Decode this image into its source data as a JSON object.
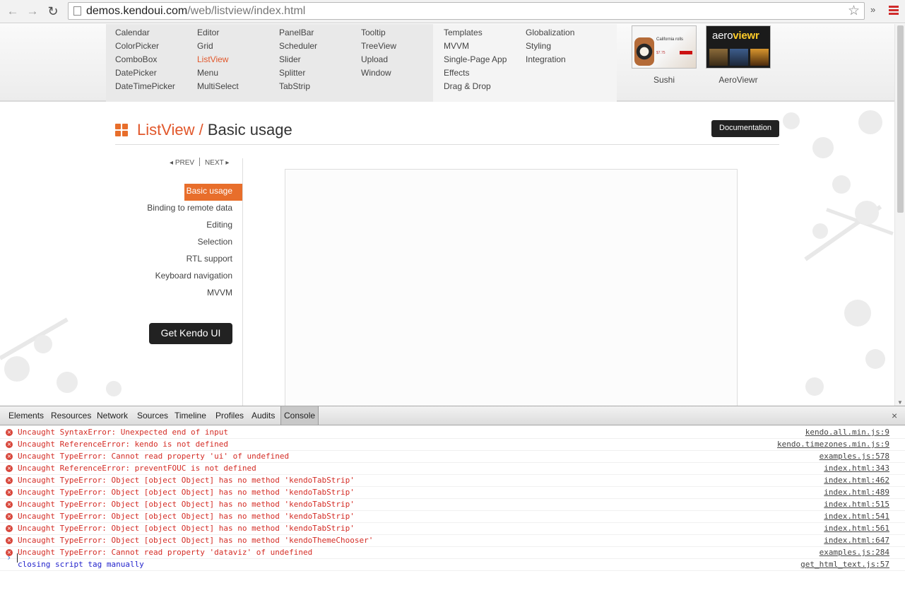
{
  "browser": {
    "url_host": "demos.kendoui.com",
    "url_path": "/web/listview/index.html"
  },
  "menu": {
    "col1": [
      "Calendar",
      "ColorPicker",
      "ComboBox",
      "DatePicker",
      "DateTimePicker"
    ],
    "col2": [
      "Editor",
      "Grid",
      "ListView",
      "Menu",
      "MultiSelect"
    ],
    "col3": [
      "PanelBar",
      "Scheduler",
      "Slider",
      "Splitter",
      "TabStrip"
    ],
    "col4": [
      "Tooltip",
      "TreeView",
      "Upload",
      "Window"
    ],
    "col5": [
      "Templates",
      "MVVM",
      "Single-Page App",
      "Effects",
      "Drag & Drop"
    ],
    "col6": [
      "Globalization",
      "Styling",
      "Integration"
    ],
    "active": "ListView",
    "showcase": [
      {
        "label": "Sushi",
        "thumb_title": "California rolls",
        "thumb_price": "$7.75"
      },
      {
        "label": "AeroViewr",
        "logo_light": "aero",
        "logo_bold": "viewr"
      }
    ]
  },
  "page": {
    "widget": "ListView",
    "separator": " / ",
    "title": "Basic usage",
    "documentation_label": "Documentation",
    "prev_label": "PREV",
    "next_label": "NEXT",
    "prev_arrow": "◂",
    "next_arrow": "▸",
    "get_kendo_label": "Get Kendo UI"
  },
  "sidenav": {
    "active_index": 0,
    "items": [
      "Basic usage",
      "Binding to remote data",
      "Editing",
      "Selection",
      "RTL support",
      "Keyboard navigation",
      "MVVM"
    ]
  },
  "devtools": {
    "tabs": [
      "Elements",
      "Resources",
      "Network",
      "Sources",
      "Timeline",
      "Profiles",
      "Audits",
      "Console"
    ],
    "selected_tab": "Console",
    "close_glyph": "×",
    "prompt_glyph": "›",
    "logs": [
      {
        "type": "error",
        "message": "Uncaught SyntaxError: Unexpected end of input",
        "source": "kendo.all.min.js:9"
      },
      {
        "type": "error",
        "message": "Uncaught ReferenceError: kendo is not defined",
        "source": "kendo.timezones.min.js:9"
      },
      {
        "type": "error",
        "message": "Uncaught TypeError: Cannot read property 'ui' of undefined",
        "source": "examples.js:578"
      },
      {
        "type": "error",
        "message": "Uncaught ReferenceError: preventFOUC is not defined",
        "source": "index.html:343"
      },
      {
        "type": "error",
        "message": "Uncaught TypeError: Object [object Object] has no method 'kendoTabStrip'",
        "source": "index.html:462"
      },
      {
        "type": "error",
        "message": "Uncaught TypeError: Object [object Object] has no method 'kendoTabStrip'",
        "source": "index.html:489"
      },
      {
        "type": "error",
        "message": "Uncaught TypeError: Object [object Object] has no method 'kendoTabStrip'",
        "source": "index.html:515"
      },
      {
        "type": "error",
        "message": "Uncaught TypeError: Object [object Object] has no method 'kendoTabStrip'",
        "source": "index.html:541"
      },
      {
        "type": "error",
        "message": "Uncaught TypeError: Object [object Object] has no method 'kendoTabStrip'",
        "source": "index.html:561"
      },
      {
        "type": "error",
        "message": "Uncaught TypeError: Object [object Object] has no method 'kendoThemeChooser'",
        "source": "index.html:647"
      },
      {
        "type": "error",
        "message": "Uncaught TypeError: Cannot read property 'dataviz' of undefined",
        "source": "examples.js:284"
      },
      {
        "type": "info",
        "message": "closing script tag manually",
        "source": "get_html_text.js:57"
      }
    ]
  },
  "icons": {
    "back": "←",
    "forward": "→",
    "reload": "↻",
    "star": "☆",
    "extensions": "»"
  },
  "colors": {
    "accent": "#e86e2b",
    "error": "#d42c25",
    "info": "#2222cc"
  }
}
